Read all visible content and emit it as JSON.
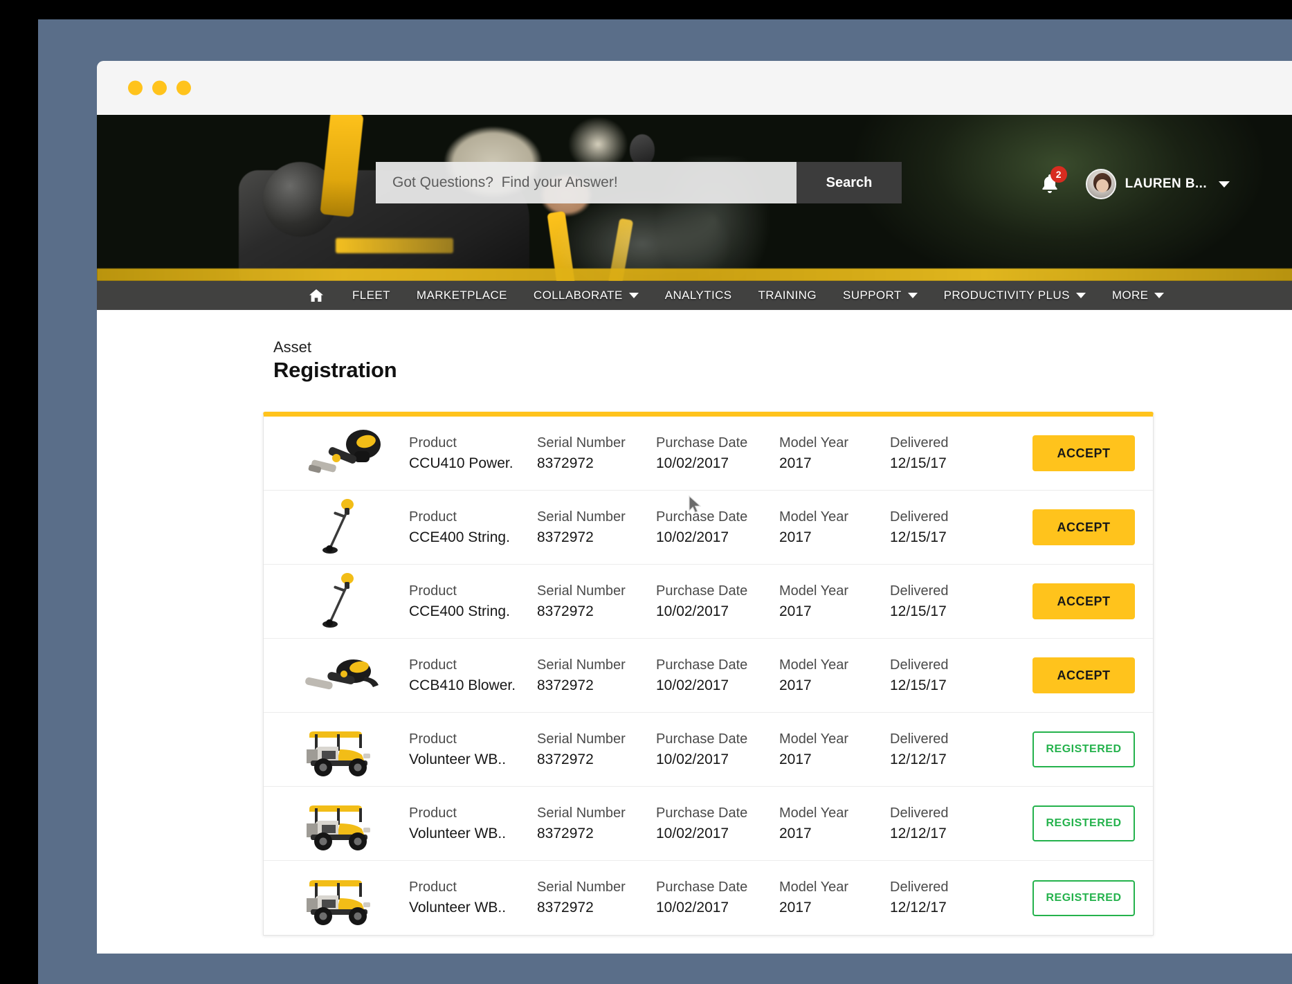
{
  "window": {
    "dots": [
      "dot-1",
      "dot-2",
      "dot-3"
    ]
  },
  "header": {
    "search": {
      "placeholder": "Got Questions?  Find your Answer!",
      "value": "",
      "button_label": "Search"
    },
    "notifications": {
      "icon": "bell-icon",
      "count": "2"
    },
    "user": {
      "name": "LAUREN B...",
      "avatar": "user-avatar",
      "caret": "chevron-down-icon"
    }
  },
  "nav": {
    "items": [
      {
        "label": "",
        "icon": "home-icon",
        "has_caret": false
      },
      {
        "label": "FLEET",
        "has_caret": false
      },
      {
        "label": "MARKETPLACE",
        "has_caret": false
      },
      {
        "label": "COLLABORATE",
        "has_caret": true
      },
      {
        "label": "ANALYTICS",
        "has_caret": false
      },
      {
        "label": "TRAINING",
        "has_caret": false
      },
      {
        "label": "SUPPORT",
        "has_caret": true
      },
      {
        "label": "PRODUCTIVITY PLUS",
        "has_caret": true
      },
      {
        "label": "MORE",
        "has_caret": true
      }
    ]
  },
  "page": {
    "kicker": "Asset",
    "title": "Registration",
    "accent_color": "#ffc31c"
  },
  "table": {
    "labels": {
      "product": "Product",
      "serial": "Serial Number",
      "purchase": "Purchase Date",
      "model_year": "Model Year",
      "delivered": "Delivered"
    },
    "rows": [
      {
        "thumb": "power-head-tool-image",
        "product": "CCU410 Power.",
        "serial": "8372972",
        "purchase": "10/02/2017",
        "model_year": "2017",
        "delivered": "12/15/17",
        "action": "ACCEPT",
        "status": "accept"
      },
      {
        "thumb": "string-trimmer-image",
        "product": "CCE400 String.",
        "serial": "8372972",
        "purchase": "10/02/2017",
        "model_year": "2017",
        "delivered": "12/15/17",
        "action": "ACCEPT",
        "status": "accept"
      },
      {
        "thumb": "string-trimmer-image",
        "product": "CCE400 String.",
        "serial": "8372972",
        "purchase": "10/02/2017",
        "model_year": "2017",
        "delivered": "12/15/17",
        "action": "ACCEPT",
        "status": "accept"
      },
      {
        "thumb": "leaf-blower-image",
        "product": "CCB410 Blower.",
        "serial": "8372972",
        "purchase": "10/02/2017",
        "model_year": "2017",
        "delivered": "12/15/17",
        "action": "ACCEPT",
        "status": "accept"
      },
      {
        "thumb": "utility-vehicle-image",
        "product": "Volunteer WB..",
        "serial": "8372972",
        "purchase": "10/02/2017",
        "model_year": "2017",
        "delivered": "12/12/17",
        "action": "REGISTERED",
        "status": "registered"
      },
      {
        "thumb": "utility-vehicle-image",
        "product": "Volunteer WB..",
        "serial": "8372972",
        "purchase": "10/02/2017",
        "model_year": "2017",
        "delivered": "12/12/17",
        "action": "REGISTERED",
        "status": "registered"
      },
      {
        "thumb": "utility-vehicle-image",
        "product": "Volunteer WB..",
        "serial": "8372972",
        "purchase": "10/02/2017",
        "model_year": "2017",
        "delivered": "12/12/17",
        "action": "REGISTERED",
        "status": "registered"
      }
    ]
  },
  "colors": {
    "accent_yellow": "#ffc31c",
    "registered_green": "#24b24c",
    "badge_red": "#d82c20",
    "frame_slate": "#5a6e89",
    "nav_dark": "#121210"
  }
}
